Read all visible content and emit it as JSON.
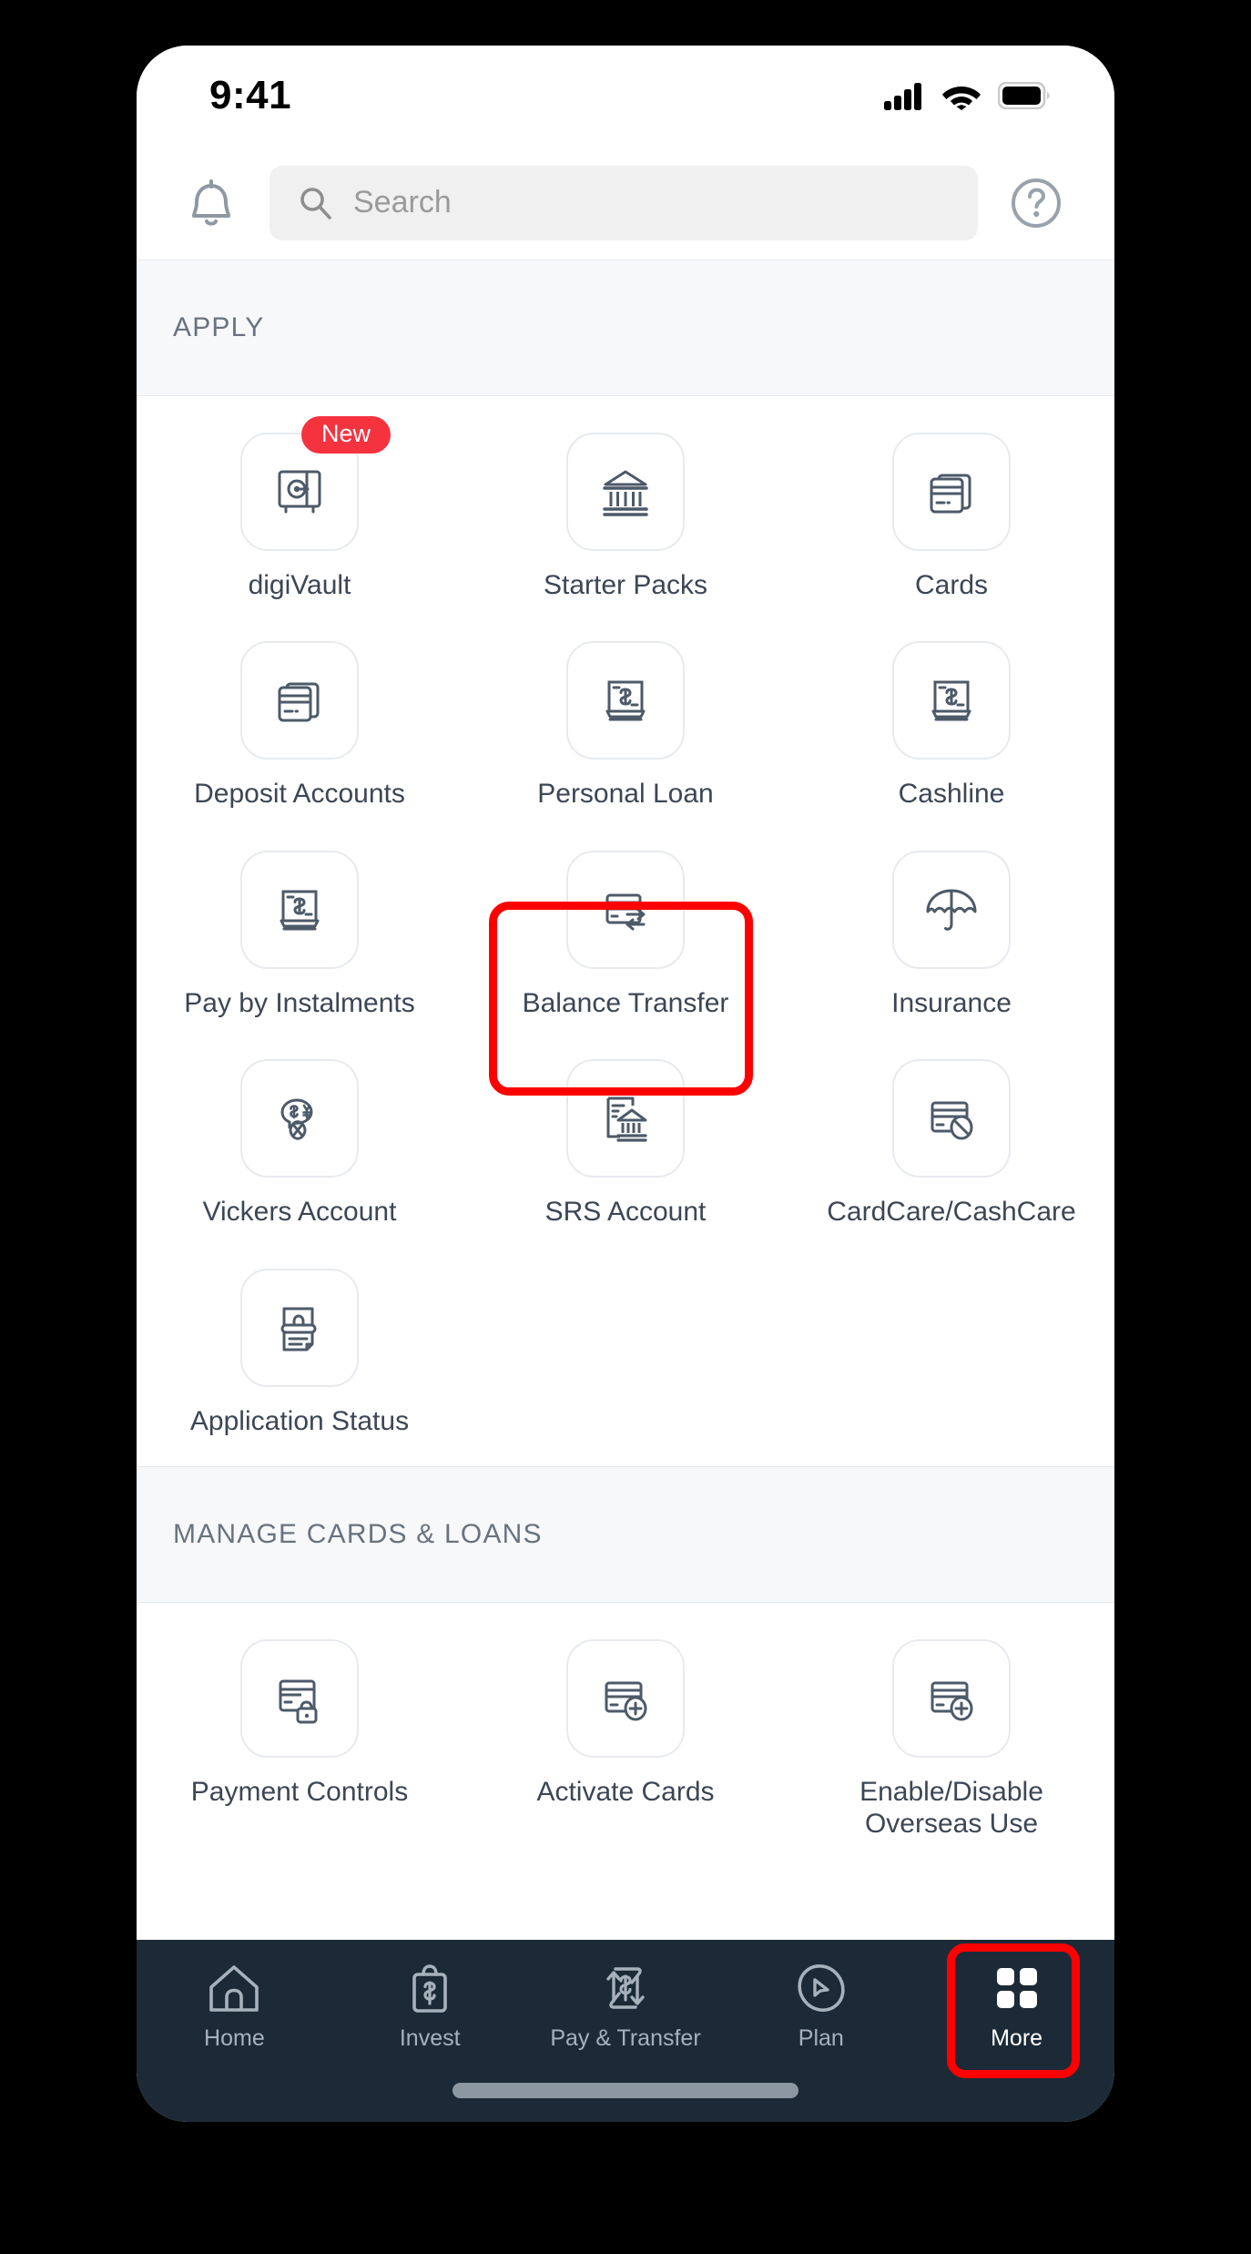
{
  "status_bar": {
    "time": "9:41",
    "icons": [
      "signal-icon",
      "wifi-icon",
      "battery-icon"
    ]
  },
  "header": {
    "notifications_icon": "bell-icon",
    "help_icon": "help-circle-icon",
    "search": {
      "icon": "search-icon",
      "placeholder": "Search",
      "value": ""
    }
  },
  "colors": {
    "accent_red": "#f5333f",
    "highlight_red": "#ff0000",
    "nav_background": "#1c2a38",
    "section_background": "#f7f8fa",
    "tile_border": "#e7eaee",
    "label_text": "#3c4655",
    "section_text": "#69737f"
  },
  "sections": [
    {
      "title": "APPLY",
      "tiles": [
        {
          "label": "digiVault",
          "icon": "vault-icon",
          "badge": "New",
          "highlighted": false
        },
        {
          "label": "Starter Packs",
          "icon": "bank-icon",
          "badge": null,
          "highlighted": false
        },
        {
          "label": "Cards",
          "icon": "cards-stack-icon",
          "badge": null,
          "highlighted": false
        },
        {
          "label": "Deposit Accounts",
          "icon": "cards-stack-icon",
          "badge": null,
          "highlighted": false
        },
        {
          "label": "Personal Loan",
          "icon": "cash-stack-icon",
          "badge": null,
          "highlighted": false
        },
        {
          "label": "Cashline",
          "icon": "cash-stack-icon",
          "badge": null,
          "highlighted": false
        },
        {
          "label": "Pay by Instalments",
          "icon": "cash-stack-icon",
          "badge": null,
          "highlighted": false
        },
        {
          "label": "Balance Transfer",
          "icon": "card-transfer-icon",
          "badge": null,
          "highlighted": true
        },
        {
          "label": "Insurance",
          "icon": "umbrella-icon",
          "badge": null,
          "highlighted": false
        },
        {
          "label": "Vickers Account",
          "icon": "currency-exchange-icon",
          "badge": null,
          "highlighted": false
        },
        {
          "label": "SRS Account",
          "icon": "document-bank-icon",
          "badge": null,
          "highlighted": false
        },
        {
          "label": "CardCare/CashCare",
          "icon": "card-block-icon",
          "badge": null,
          "highlighted": false
        },
        {
          "label": "Application Status",
          "icon": "document-status-icon",
          "badge": null,
          "highlighted": false
        }
      ]
    },
    {
      "title": "MANAGE CARDS & LOANS",
      "tiles": [
        {
          "label": "Payment Controls",
          "icon": "card-lock-icon",
          "badge": null,
          "highlighted": false
        },
        {
          "label": "Activate Cards",
          "icon": "card-plus-icon",
          "badge": null,
          "highlighted": false
        },
        {
          "label": "Enable/Disable Overseas Use",
          "icon": "card-plus-icon",
          "badge": null,
          "highlighted": false
        }
      ]
    }
  ],
  "bottom_nav": {
    "items": [
      {
        "label": "Home",
        "icon": "home-icon",
        "active": false,
        "highlighted": false
      },
      {
        "label": "Invest",
        "icon": "invest-bag-icon",
        "active": false,
        "highlighted": false
      },
      {
        "label": "Pay & Transfer",
        "icon": "pay-transfer-icon",
        "active": false,
        "highlighted": false
      },
      {
        "label": "Plan",
        "icon": "plan-compass-icon",
        "active": false,
        "highlighted": false
      },
      {
        "label": "More",
        "icon": "grid-more-icon",
        "active": true,
        "highlighted": true
      }
    ]
  }
}
